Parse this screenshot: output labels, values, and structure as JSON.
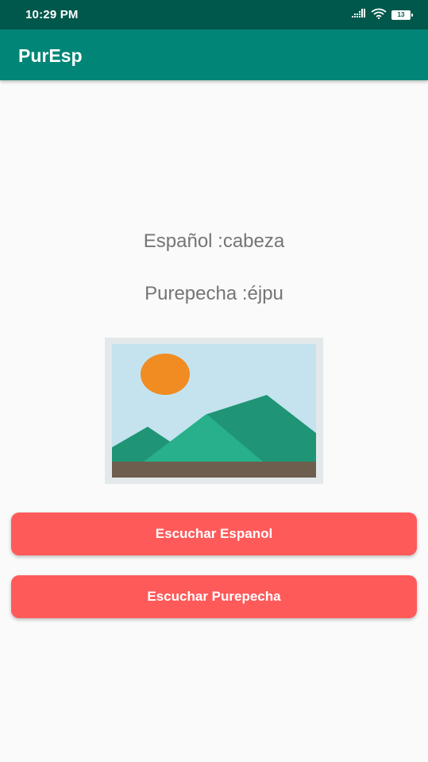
{
  "status_bar": {
    "time": "10:29 PM",
    "icons": [
      "signal-icon",
      "wifi-icon",
      "battery-icon"
    ],
    "battery_level": "13"
  },
  "app_bar": {
    "title": "PurEsp"
  },
  "content": {
    "spanish_line": "Español :cabeza",
    "purepecha_line": "Purepecha :éjpu",
    "image_icon": "landscape-placeholder-icon"
  },
  "buttons": {
    "listen_spanish": "Escuchar Espanol",
    "listen_purepecha": "Escuchar Purepecha"
  },
  "colors": {
    "status_bar": "#00574b",
    "app_bar": "#008577",
    "button": "#ff5a5a",
    "background": "#fafafa",
    "text_secondary": "#757575"
  }
}
